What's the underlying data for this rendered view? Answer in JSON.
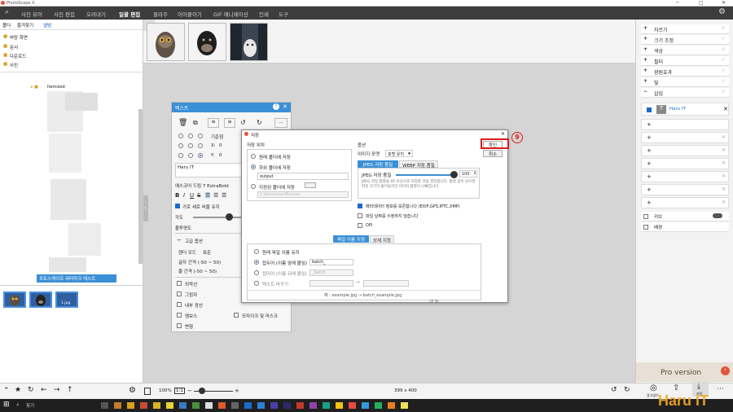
{
  "app": {
    "title": "PhotoScape X"
  },
  "menu": {
    "items": [
      "사진 뷰어",
      "사진 편집",
      "오려내기",
      "일괄 편집",
      "콜라주",
      "이어붙이기",
      "GIF 애니메이션",
      "인쇄",
      "도구"
    ],
    "active_index": 3
  },
  "left": {
    "tabs": [
      "폴더",
      "즐겨찾기",
      "앨범"
    ],
    "folders": [
      "바탕 화면",
      "문서",
      "다운로드",
      "사진"
    ],
    "tree_item": "Itemized",
    "selected_folder": "포토스케이프 워터마크 테스트",
    "bottom_thumb_label": "1.jpg"
  },
  "right": {
    "items": [
      {
        "label": "자르기",
        "checked": true
      },
      {
        "label": "크기 조정",
        "checked": false
      },
      {
        "label": "색상",
        "checked": true
      },
      {
        "label": "필터",
        "checked": false
      },
      {
        "label": "광원효과",
        "checked": false
      },
      {
        "label": "빛",
        "checked": false
      },
      {
        "label": "삽입",
        "checked": true
      }
    ],
    "layer_name": "Haru IT",
    "border_label": "커브",
    "bg_label": "배경",
    "pro_text": "Pro version",
    "upgrade_label": "광고없이",
    "save_label": "저장"
  },
  "text_panel": {
    "title": "텍스트",
    "default_pos_label": "기준점",
    "x_label": "X:",
    "x_value": "0",
    "y_label": "Y:",
    "y_value": "0",
    "text_value": "Haru IT",
    "font_name": "에스코어 드림 7 ExtraBold",
    "keep_ratio": "가로 세로 비율 유지",
    "angle_label": "각도",
    "opacity_label": "불투명도",
    "advanced": "고급 옵션",
    "render_mode_label": "렌더 모드",
    "render_mode_value": "표준",
    "char_space_label": "글자 간격 (-50 ~ 50)",
    "line_space_label": "줄 간격 (-50 ~ 50)",
    "options": [
      "외곽선",
      "그림자",
      "내부 광선",
      "엠보스",
      "변형"
    ],
    "option_extra": "모자이크 및 마스크"
  },
  "dialog": {
    "title": "저장",
    "save_location_heading": "저장 위치",
    "loc_options": [
      "원래 폴더에 저장",
      "하위 폴더에 저장",
      "지정된 폴더에 저장"
    ],
    "subfolder_value": "output",
    "path_placeholder": "C:\\Users\\user\\Pictures",
    "option_heading": "옵션",
    "format_label": "이미지 포맷",
    "format_value": "포맷 유지",
    "tab_jpeg": "JPEG 저장 품질",
    "tab_webp": "WEBP 저장 품질",
    "quality_label": "JPEG 저장 품질",
    "quality_value": "100",
    "quality_desc": "JPEG 저장 품질을 95 이상으로 지정할 것을 권장합니다. 품질 값이 낮으면 파일 크기가 줄어들지만 이미지 품질이 나빠집니다.",
    "metadata_label": "메타데이터 정보를 보존합니다 (EXIF,GPS,IPTC,XMP)",
    "keep_date_label": "파일 날짜를 수정하지 않습니다",
    "dpi_label": "DPI",
    "tab_filename": "파일 이름 지정",
    "tab_detail": "상세 지정",
    "name_options": [
      "원래 파일 이름 유지",
      "접두어 (이름 앞에 붙임)",
      "접미어 (이름 뒤에 붙임)",
      "텍스트 바꾸기"
    ],
    "prefix_value": "batch_",
    "suffix_value": "_batch",
    "arrow": "→",
    "example": "예 : example.jpg → batch_example.jpg",
    "ok_label": "확인",
    "cancel_label": "취소",
    "annotation_number": "9"
  },
  "bottom": {
    "zoom": "100%",
    "one_to_one": "1:1",
    "image_size": "399 x 400"
  },
  "taskbar": {
    "search": "찾기",
    "watermark": "Haru IT"
  }
}
